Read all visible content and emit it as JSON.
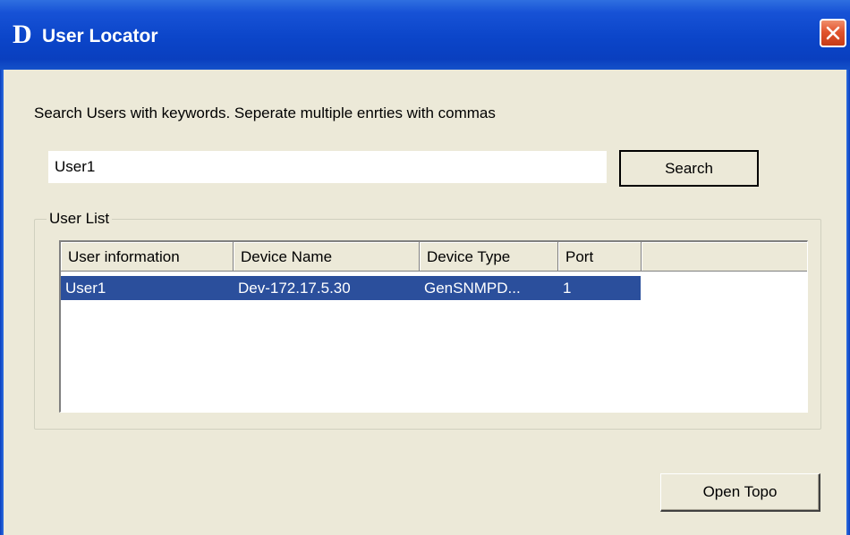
{
  "window": {
    "logo": "D",
    "title": "User Locator",
    "close_icon": "close-icon"
  },
  "instruction": "Search Users with keywords. Seperate multiple enrties with commas",
  "search": {
    "value": "User1",
    "button_label": "Search"
  },
  "user_list": {
    "label": "User List",
    "columns": [
      "User information",
      "Device Name",
      "Device Type",
      "Port"
    ],
    "rows": [
      {
        "user_information": "User1",
        "device_name": "Dev-172.17.5.30",
        "device_type": "GenSNMPD...",
        "port": "1",
        "selected": true
      }
    ]
  },
  "open_topo_label": "Open Topo",
  "colors": {
    "titlebar": "#0a3fbf",
    "window_background": "#ece9d8",
    "selection": "#2b4f9c",
    "close_button": "#e2542d"
  }
}
